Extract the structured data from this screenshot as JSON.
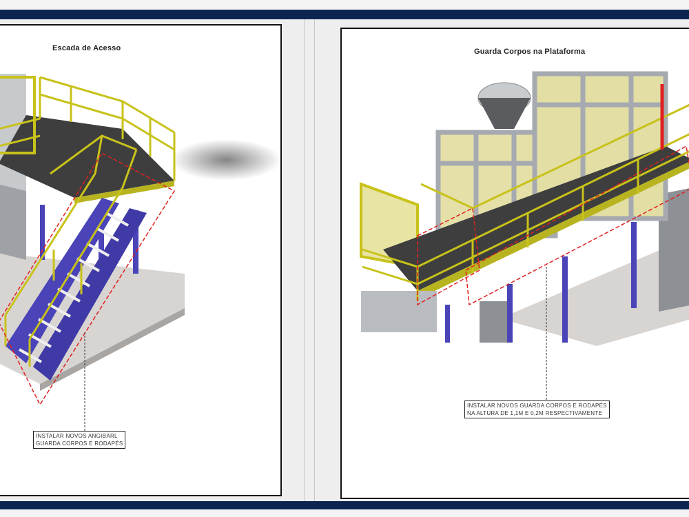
{
  "pages": {
    "left": {
      "title": "Escada de Acesso",
      "callout_line1": "INSTALAR NOVOS ANGIBARL",
      "callout_line2": "GUARDA CORPOS E RODAPÉS"
    },
    "right": {
      "title": "Guarda Corpos na Plataforma",
      "callout_line1": "INSTALAR NOVOS GUARDA CORPOS E RODAPÉS",
      "callout_line2": "NA ALTURA DE 1,1M E 0,2M RESPECTIVAMENTE"
    }
  },
  "colors": {
    "frame_bar": "#0b2550",
    "railing_yellow": "#c8c21a",
    "steel_blue": "#4a44b8",
    "deck_dark": "#3c3c3c",
    "structure_gray": "#b8bcc0",
    "highlight_red": "#e02020"
  }
}
